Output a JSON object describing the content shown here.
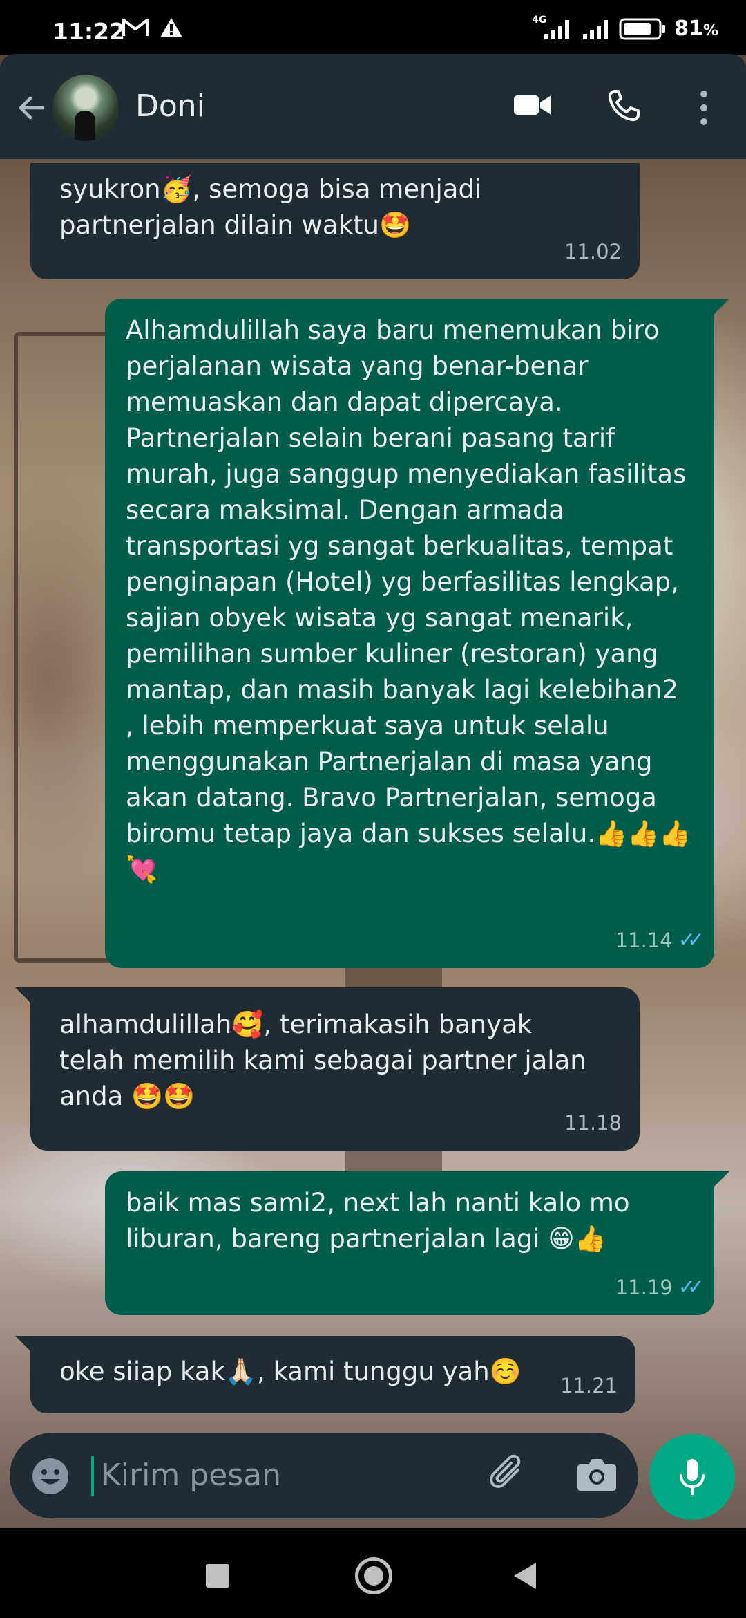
{
  "status_bar": {
    "time": "11:22",
    "network": "4G",
    "battery_percent": "81",
    "battery_level": 0.81
  },
  "header": {
    "contact_name": "Doni",
    "icons": [
      "back-arrow-icon",
      "video-call-icon",
      "voice-call-icon",
      "more-options-icon"
    ]
  },
  "messages": [
    {
      "direction": "incoming",
      "text": "syukron🥳, semoga bisa menjadi\npartnerjalan dilain waktu🤩",
      "time": "11.02"
    },
    {
      "direction": "outgoing",
      "text": "Alhamdulillah saya baru menemukan biro perjalanan wisata yang benar-benar memuaskan dan dapat dipercaya. Partnerjalan selain berani pasang tarif murah, juga sanggup menyediakan fasilitas secara maksimal. Dengan armada transportasi yg sangat berkualitas, tempat penginapan (Hotel) yg berfasilitas lengkap, sajian obyek wisata yg sangat menarik, pemilihan sumber kuliner (restoran) yang mantap, dan masih banyak lagi kelebihan2 , lebih memperkuat saya untuk selalu menggunakan Partnerjalan di masa yang akan datang. Bravo  Partnerjalan, semoga biromu tetap jaya dan sukses selalu.👍👍👍💘",
      "time": "11.14",
      "read": true
    },
    {
      "direction": "incoming",
      "text": "alhamdulillah🥰, terimakasih banyak\ntelah memilih kami sebagai partner jalan\nanda 🤩🤩",
      "time": "11.18"
    },
    {
      "direction": "outgoing",
      "text": "baik mas sami2, next lah nanti kalo mo\nliburan, bareng partnerjalan lagi 😁👍",
      "time": "11.19",
      "read": true
    },
    {
      "direction": "incoming",
      "text": "oke siiap kak🙏🏻, kami tunggu yah☺️",
      "time": "11.21"
    }
  ],
  "composer": {
    "placeholder": "Kirim pesan",
    "icons": [
      "emoji-icon",
      "attach-icon",
      "camera-icon",
      "mic-icon"
    ]
  },
  "nav_bar": {
    "icons": [
      "recents-icon",
      "home-icon",
      "back-icon"
    ]
  },
  "colors": {
    "header": "#1f2c34",
    "incoming_bubble": "#1f2c34",
    "outgoing_bubble": "#005c4b",
    "accent": "#00a884",
    "read_check": "#53bdeb"
  }
}
